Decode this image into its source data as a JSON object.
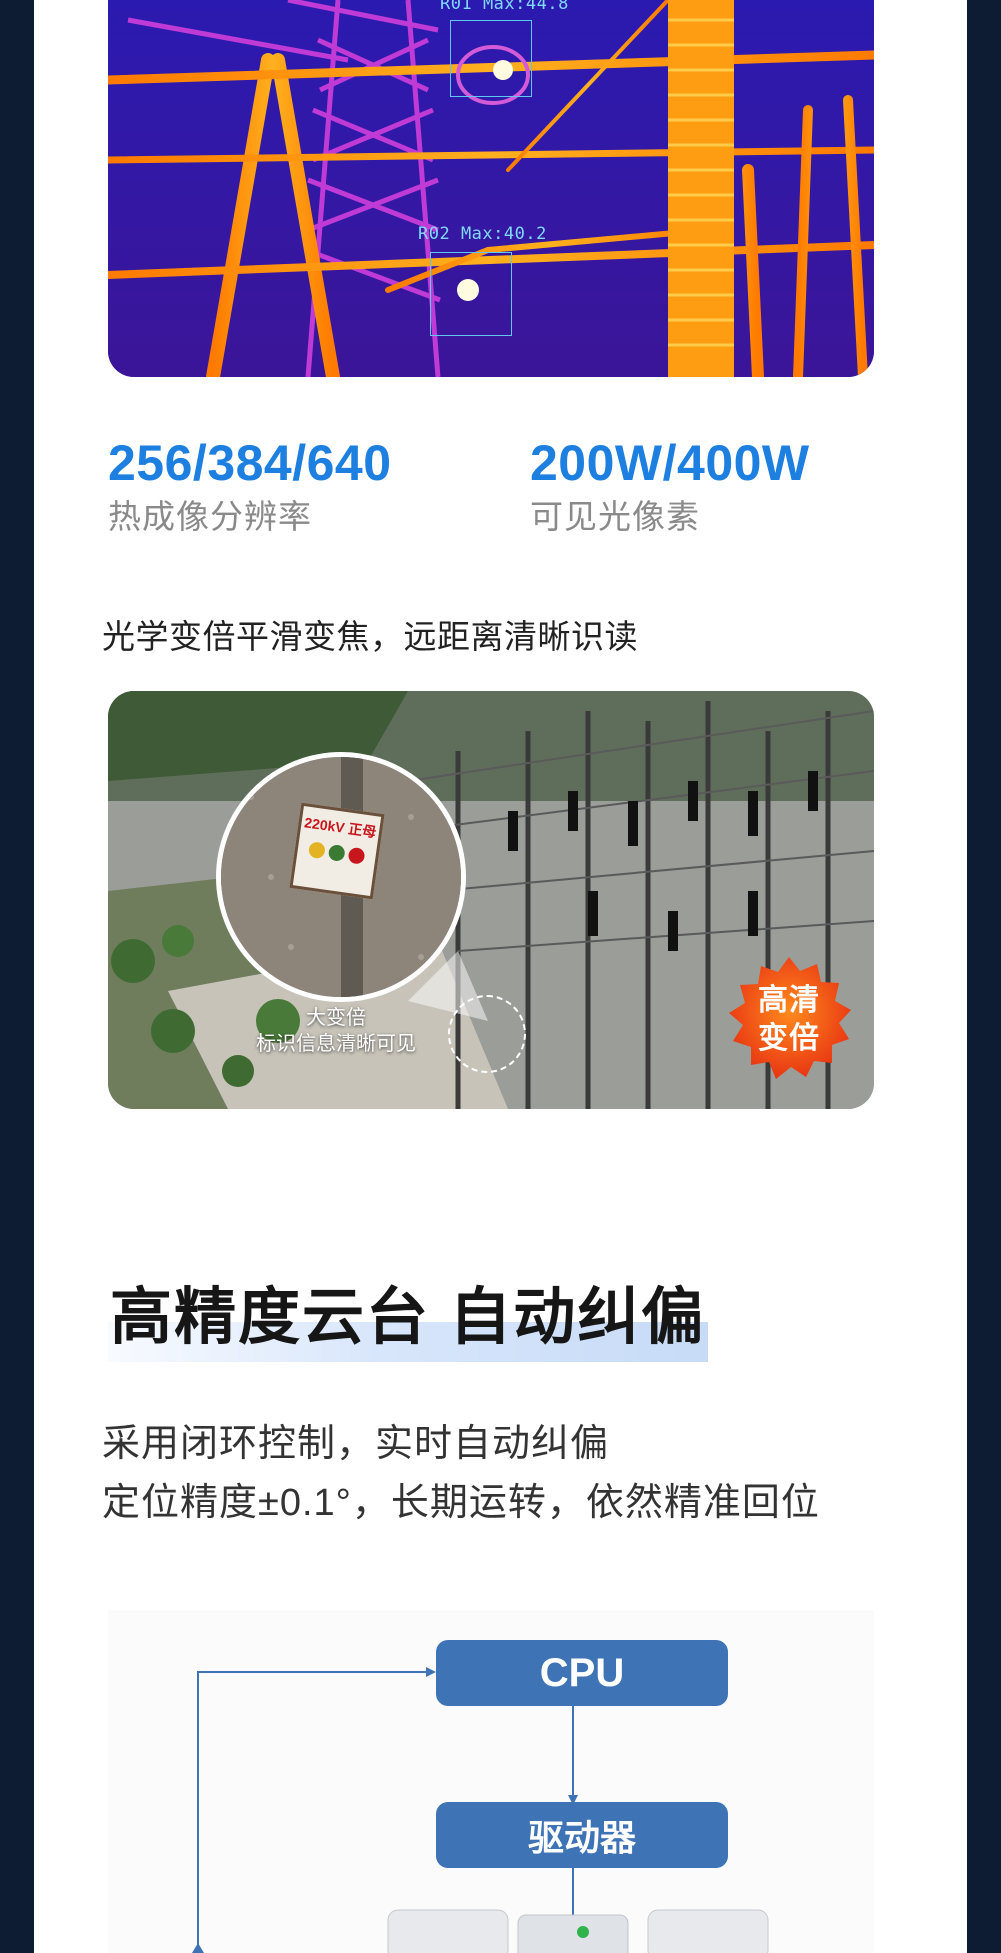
{
  "thermal_image": {
    "roi1_label": "R01 Max:44.8",
    "roi2_label": "R02 Max:40.2"
  },
  "stats": [
    {
      "value": "256/384/640",
      "label": "热成像分辨率"
    },
    {
      "value": "200W/400W",
      "label": "可见光像素"
    }
  ],
  "zoom_section": {
    "caption": "光学变倍平滑变焦，远距离清晰识读",
    "sign_text": "220kV 正母",
    "zoom_caption_line1": "大变倍",
    "zoom_caption_line2": "标识信息清晰可见",
    "badge_line1": "高清",
    "badge_line2": "变倍"
  },
  "ptz_section": {
    "title": "高精度云台 自动纠偏",
    "desc_line1": "采用闭环控制，实时自动纠偏",
    "desc_line2": "定位精度±0.1°，长期运转，依然精准回位"
  },
  "diagram": {
    "box1": "CPU",
    "box2": "驱动器"
  },
  "colors": {
    "accent": "#1d7fe0",
    "page_bg": "#0d1b33",
    "flow_box": "#3e73b6",
    "badge": "#f05a14"
  }
}
